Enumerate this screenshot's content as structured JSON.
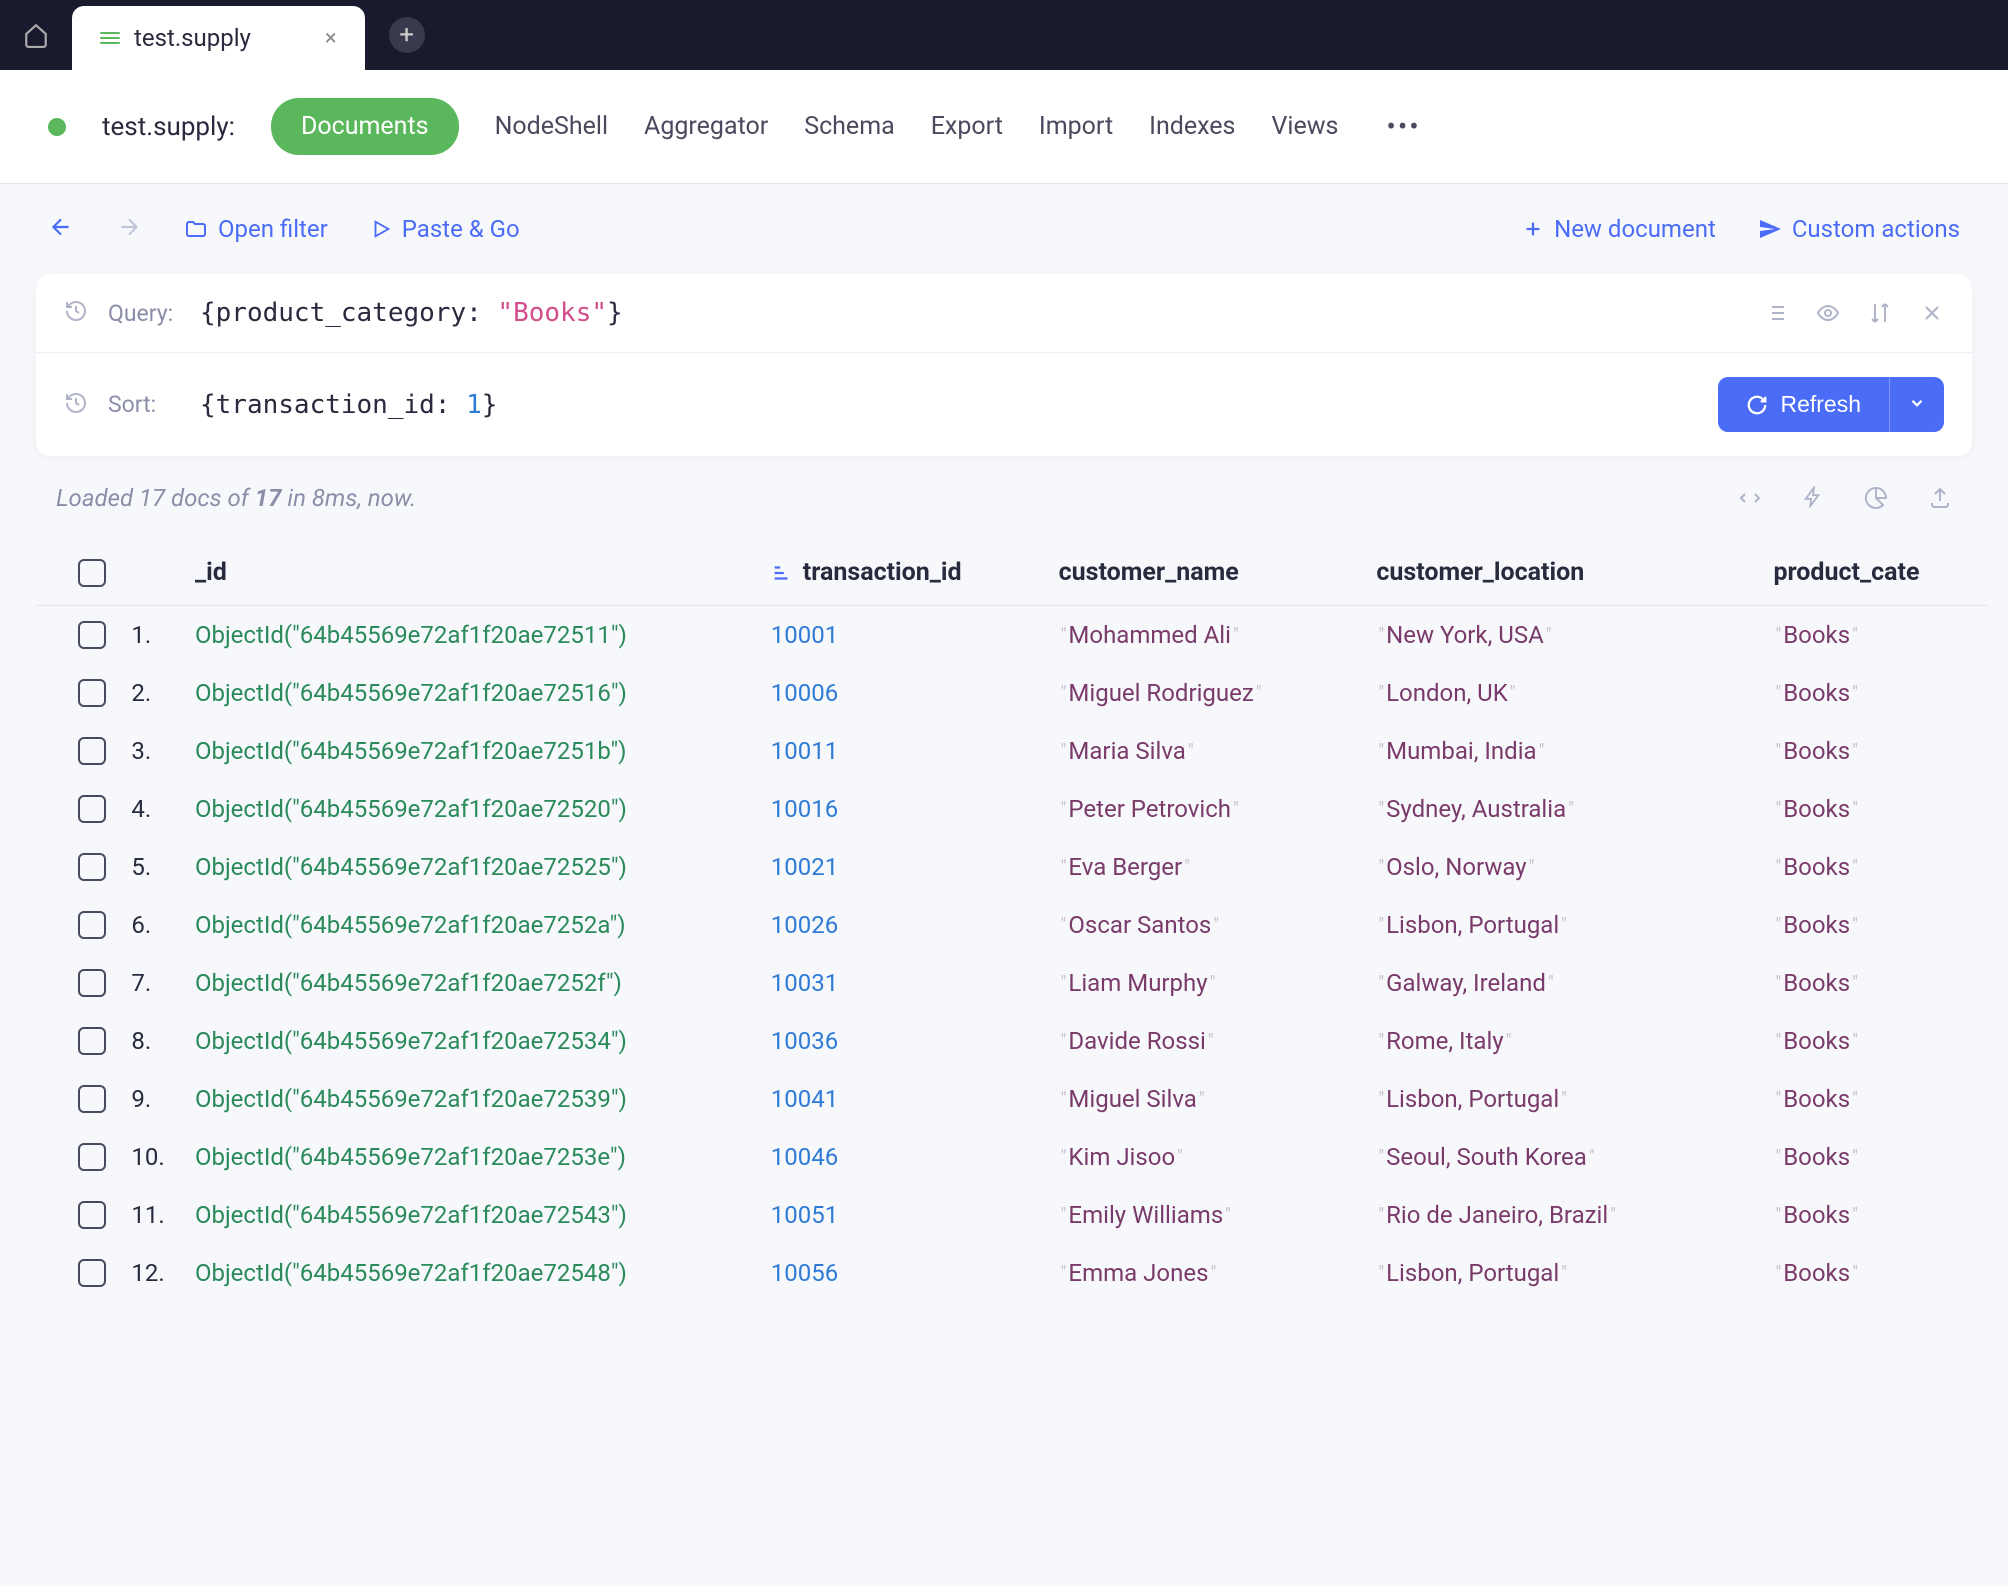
{
  "tab": {
    "title": "test.supply"
  },
  "nav": {
    "title": "test.supply:",
    "active": "Documents",
    "links": [
      "NodeShell",
      "Aggregator",
      "Schema",
      "Export",
      "Import",
      "Indexes",
      "Views"
    ]
  },
  "toolbar": {
    "open_filter": "Open filter",
    "paste_go": "Paste & Go",
    "new_doc": "New document",
    "custom_actions": "Custom actions"
  },
  "query": {
    "label": "Query:",
    "prefix": "{product_category: ",
    "value": "\"Books\"",
    "suffix": "}"
  },
  "sort": {
    "label": "Sort:",
    "prefix": "{transaction_id: ",
    "value": "1",
    "suffix": "}",
    "refresh": "Refresh"
  },
  "status": {
    "loaded_prefix": "Loaded 17 docs of ",
    "total": "17",
    "suffix": " in 8ms, now."
  },
  "columns": {
    "id": "_id",
    "tx": "transaction_id",
    "cust": "customer_name",
    "loc": "customer_location",
    "cat": "product_cate"
  },
  "rows": [
    {
      "idx": "1.",
      "oid": "ObjectId(\"64b45569e72af1f20ae72511\")",
      "tx": "10001",
      "cust": "Mohammed Ali",
      "loc": "New York, USA",
      "cat": "Books"
    },
    {
      "idx": "2.",
      "oid": "ObjectId(\"64b45569e72af1f20ae72516\")",
      "tx": "10006",
      "cust": "Miguel Rodriguez",
      "loc": "London, UK",
      "cat": "Books"
    },
    {
      "idx": "3.",
      "oid": "ObjectId(\"64b45569e72af1f20ae7251b\")",
      "tx": "10011",
      "cust": "Maria Silva",
      "loc": "Mumbai, India",
      "cat": "Books"
    },
    {
      "idx": "4.",
      "oid": "ObjectId(\"64b45569e72af1f20ae72520\")",
      "tx": "10016",
      "cust": "Peter Petrovich",
      "loc": "Sydney, Australia",
      "cat": "Books"
    },
    {
      "idx": "5.",
      "oid": "ObjectId(\"64b45569e72af1f20ae72525\")",
      "tx": "10021",
      "cust": "Eva Berger",
      "loc": "Oslo, Norway",
      "cat": "Books"
    },
    {
      "idx": "6.",
      "oid": "ObjectId(\"64b45569e72af1f20ae7252a\")",
      "tx": "10026",
      "cust": "Oscar Santos",
      "loc": "Lisbon, Portugal",
      "cat": "Books"
    },
    {
      "idx": "7.",
      "oid": "ObjectId(\"64b45569e72af1f20ae7252f\")",
      "tx": "10031",
      "cust": "Liam Murphy",
      "loc": "Galway, Ireland",
      "cat": "Books"
    },
    {
      "idx": "8.",
      "oid": "ObjectId(\"64b45569e72af1f20ae72534\")",
      "tx": "10036",
      "cust": "Davide Rossi",
      "loc": "Rome, Italy",
      "cat": "Books"
    },
    {
      "idx": "9.",
      "oid": "ObjectId(\"64b45569e72af1f20ae72539\")",
      "tx": "10041",
      "cust": "Miguel Silva",
      "loc": "Lisbon, Portugal",
      "cat": "Books"
    },
    {
      "idx": "10.",
      "oid": "ObjectId(\"64b45569e72af1f20ae7253e\")",
      "tx": "10046",
      "cust": "Kim Jisoo",
      "loc": "Seoul, South Korea",
      "cat": "Books"
    },
    {
      "idx": "11.",
      "oid": "ObjectId(\"64b45569e72af1f20ae72543\")",
      "tx": "10051",
      "cust": "Emily Williams",
      "loc": "Rio de Janeiro, Brazil",
      "cat": "Books"
    },
    {
      "idx": "12.",
      "oid": "ObjectId(\"64b45569e72af1f20ae72548\")",
      "tx": "10056",
      "cust": "Emma Jones",
      "loc": "Lisbon, Portugal",
      "cat": "Books"
    }
  ]
}
